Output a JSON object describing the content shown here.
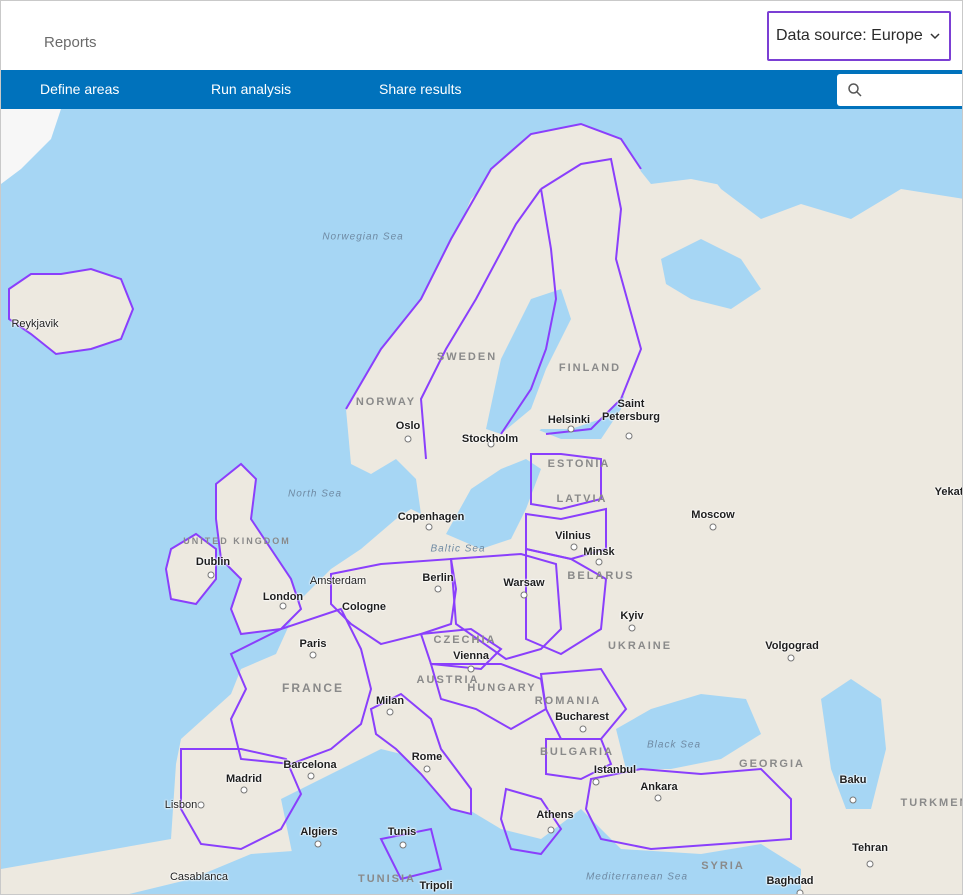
{
  "header": {
    "title": "Reports",
    "data_source_label": "Data source: Europe"
  },
  "nav": {
    "items": [
      "Define areas",
      "Run analysis",
      "Share results"
    ]
  },
  "search": {
    "placeholder": ""
  },
  "map": {
    "cities": [
      "Reykjavik",
      "Oslo",
      "Stockholm",
      "Helsinki",
      "Saint Petersburg",
      "Copenhagen",
      "Dublin",
      "London",
      "Amsterdam",
      "Berlin",
      "Cologne",
      "Warsaw",
      "Vilnius",
      "Minsk",
      "Moscow",
      "Kyiv",
      "Paris",
      "Vienna",
      "Milan",
      "Bucharest",
      "Volgograd",
      "Madrid",
      "Barcelona",
      "Rome",
      "Istanbul",
      "Ankara",
      "Baku",
      "Lisbon",
      "Algiers",
      "Tunis",
      "Athens",
      "Tehran",
      "Casablanca",
      "Tripoli",
      "Baghdad",
      "Yekat"
    ],
    "countries": [
      "SWEDEN",
      "FINLAND",
      "NORWAY",
      "ESTONIA",
      "LATVIA",
      "UNITED KINGDOM",
      "BELARUS",
      "CZECHIA",
      "UKRAINE",
      "FRANCE",
      "AUSTRIA",
      "HUNGARY",
      "ROMANIA",
      "BULGARIA",
      "GEORGIA",
      "TURKMEN",
      "SYRIA",
      "TUNISIA"
    ],
    "seas": [
      "Norwegian Sea",
      "North Sea",
      "Baltic Sea",
      "Black Sea",
      "Mediterranean Sea"
    ]
  },
  "colors": {
    "nav_bg": "#0072bc",
    "boundary": "#8a3ffc",
    "water": "#a6d6f4",
    "land": "#ede9e0",
    "focus_border": "#7b3fd4"
  }
}
